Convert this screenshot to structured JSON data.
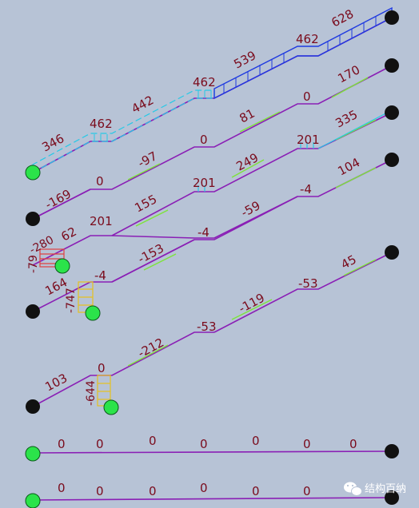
{
  "colors": {
    "background": "#b7c3d6",
    "label": "#7a0b1c",
    "beam": "#8a1fb5",
    "beam_highlight": "#7ee33a",
    "moment_cyan": "#25c9e6",
    "moment_blue": "#1f3ae0",
    "column_red": "#e04040",
    "column_yellow": "#e6c020",
    "support_green": "#2be34a",
    "support_black": "#111111"
  },
  "levels": [
    {
      "id": "level-1",
      "labels": [
        "346",
        "462",
        "442",
        "462",
        "539",
        "462",
        "628"
      ]
    },
    {
      "id": "level-2",
      "labels": [
        "0",
        "-97",
        "0",
        "81",
        "0",
        "170"
      ]
    },
    {
      "id": "level-3",
      "labels": [
        "-169",
        "201",
        "249",
        "201",
        "335"
      ]
    },
    {
      "id": "level-4",
      "labels": [
        "62",
        "201",
        "155",
        "-4",
        "-59",
        "-4",
        "104"
      ]
    },
    {
      "id": "level-5",
      "labels": [
        "164",
        "-4",
        "-153",
        "-53",
        "-119",
        "45"
      ]
    },
    {
      "id": "level-6",
      "labels": [
        "103",
        "0",
        "-212",
        "-53"
      ]
    },
    {
      "id": "level-7",
      "labels": [
        "0",
        "0",
        "0",
        "0",
        "0",
        "0",
        "0"
      ]
    },
    {
      "id": "level-8",
      "labels": [
        "0",
        "0",
        "0",
        "0",
        "0",
        "0",
        "0"
      ]
    }
  ],
  "column_labels": [
    "-79",
    "-280",
    "-747",
    "-644"
  ],
  "watermark": {
    "icon": "wechat-icon",
    "text": "结构百纳"
  }
}
